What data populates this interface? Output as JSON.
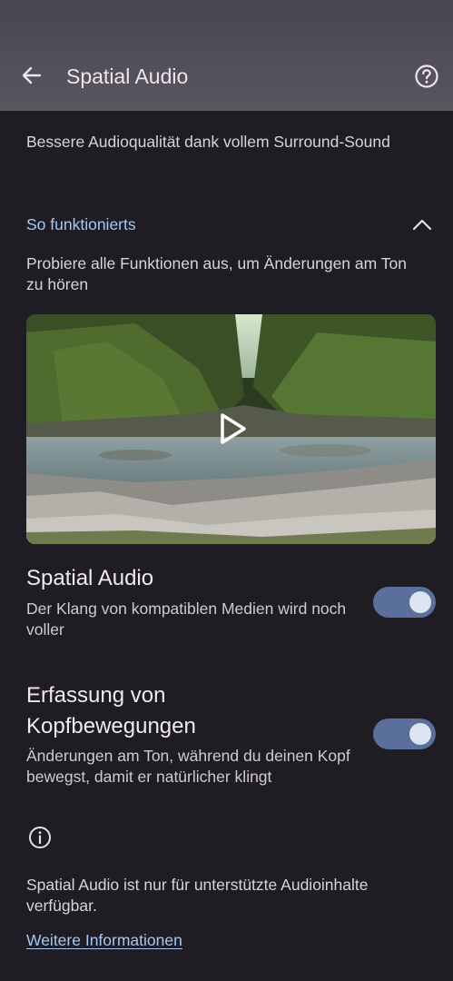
{
  "header": {
    "title": "Spatial Audio",
    "back_icon": "arrow-back-icon",
    "help_icon": "help-icon"
  },
  "subtitle": "Bessere Audioqualität dank vollem Surround-Sound",
  "how_it_works": {
    "title": "So funktionierts",
    "expanded": true,
    "description": "Probiere alle Funktionen aus, um Änderungen am Ton zu hören",
    "video_icon": "play-icon"
  },
  "settings": [
    {
      "title": "Spatial Audio",
      "description": "Der Klang von kompatiblen Medien wird noch voller",
      "enabled": true
    },
    {
      "title": "Erfassung von Kopfbewegungen",
      "description": "Änderungen am Ton, während du deinen Kopf bewegst, damit er natürlicher klingt",
      "enabled": true
    }
  ],
  "footer": {
    "info_icon": "info-icon",
    "note": "Spatial Audio ist nur für unterstützte Audioinhalte verfügbar.",
    "link": "Weitere Informationen"
  },
  "colors": {
    "background": "#1f1c24",
    "accent": "#a7c8f4",
    "toggle_track": "#5b6f9c"
  }
}
